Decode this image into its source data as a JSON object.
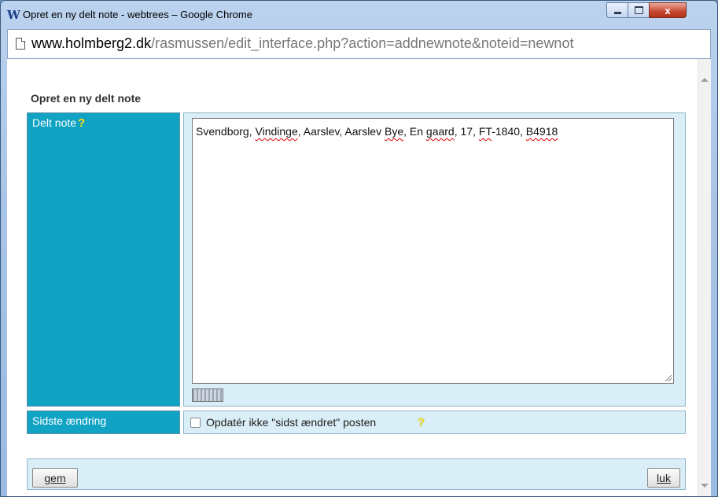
{
  "window": {
    "title": "Opret en ny delt note - webtrees – Google Chrome",
    "app_icon": "W",
    "minimize_icon": "minimize-icon",
    "maximize_icon": "maximize-icon",
    "close_icon": "x"
  },
  "address": {
    "host": "www.holmberg2.dk",
    "path": "/rasmussen/edit_interface.php?action=addnewnote&noteid=newnot"
  },
  "form": {
    "heading": "Opret en ny delt note",
    "note_label": "Delt note",
    "help_symbol": "?",
    "note_text_parts": [
      "Svendborg, ",
      "Vindinge",
      ", Aarslev, Aarslev ",
      "Bye",
      ", En ",
      "gaard",
      ", 17, ",
      "FT",
      "-1840, ",
      "B4918"
    ],
    "change_label": "Sidste ændring",
    "checkbox_label": "Opdatér ikke \"sidst ændret\" posten",
    "checkbox_checked": false
  },
  "buttons": {
    "save": "gem",
    "close": "luk"
  },
  "colors": {
    "label_bg": "#10a3c4",
    "value_bg": "#d9eef6",
    "help_icon": "#f3e332"
  }
}
